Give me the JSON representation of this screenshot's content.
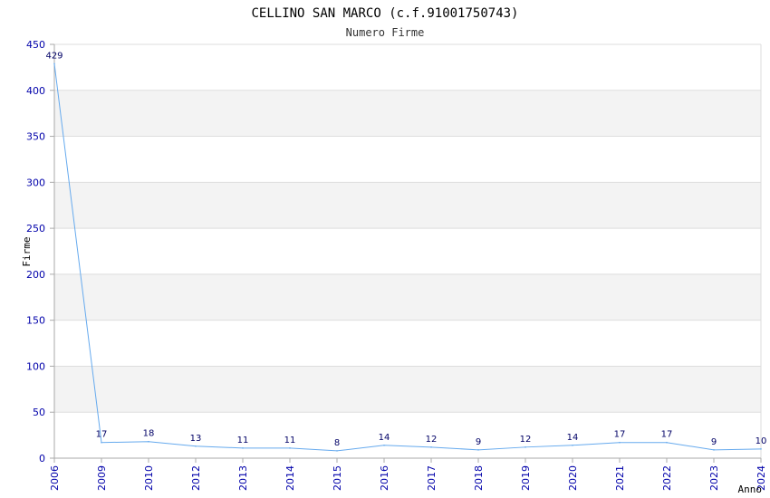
{
  "colors": {
    "line": "#66aaee",
    "band": "#f3f3f3",
    "grid": "#dddddd",
    "axis": "#aaaaaa",
    "tick_text": "#0000aa",
    "data_label": "#000066"
  },
  "chart_data": {
    "type": "line",
    "title": "CELLINO SAN MARCO (c.f.91001750743)",
    "subtitle": "Numero Firme",
    "xlabel": "Anno",
    "ylabel": "Firme",
    "categories": [
      "2006",
      "2009",
      "2010",
      "2012",
      "2013",
      "2014",
      "2015",
      "2016",
      "2017",
      "2018",
      "2019",
      "2020",
      "2021",
      "2022",
      "2023",
      "2024"
    ],
    "series": [
      {
        "values": [
          429,
          17,
          18,
          13,
          11,
          11,
          8,
          14,
          12,
          9,
          12,
          14,
          17,
          17,
          9,
          10
        ]
      }
    ],
    "ylim": [
      0,
      450
    ],
    "yticks": [
      0,
      50,
      100,
      150,
      200,
      250,
      300,
      350,
      400,
      450
    ],
    "grid": true,
    "alternating_bands": true,
    "legend": "none"
  }
}
